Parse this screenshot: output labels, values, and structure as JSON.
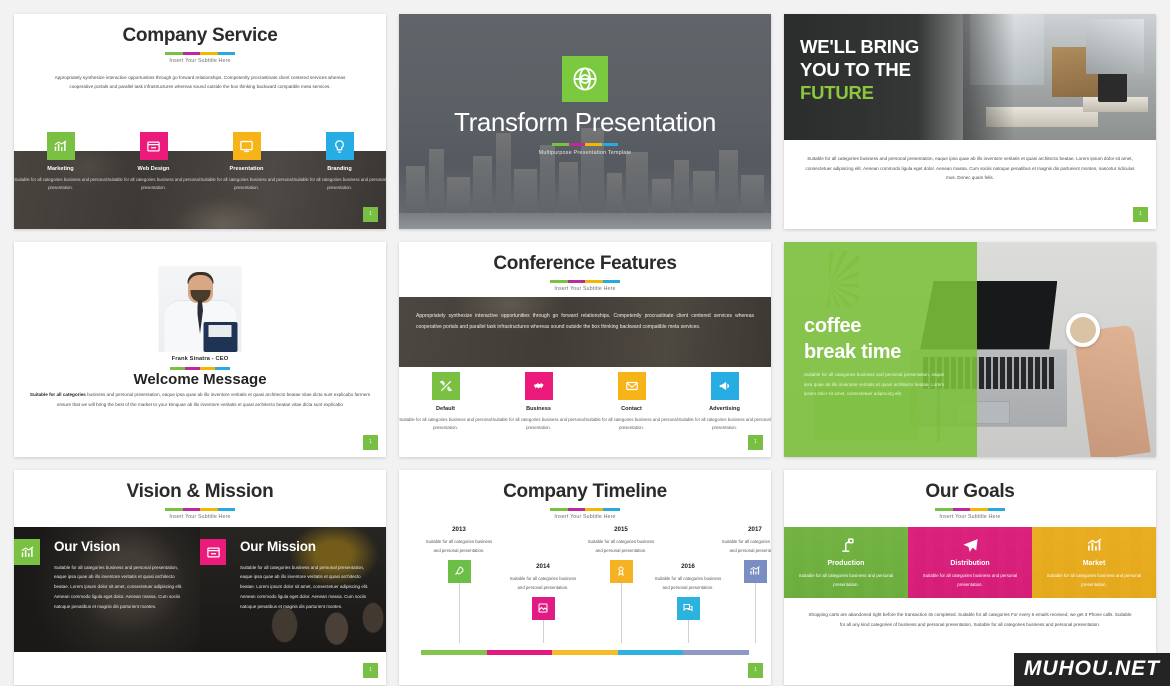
{
  "page": {
    "watermark": "MUHOU.NET",
    "page_badge": "1"
  },
  "slides": [
    {
      "id": "company-service",
      "title": "Company Service",
      "subtitle": "Insert Your Subtitle Here",
      "body": "Appropriately synthesize interactive opportunities through go forward relationships. Competently procrastinate client centered services whereas cooperative portals and parallel task infrastructures whereas sound outside the box thinking backward compatible meta services.",
      "cards": [
        {
          "icon": "bar-chart-icon",
          "color": "#7ac143",
          "title": "Marketing",
          "text": "Suitable for all categories business and personal presentation."
        },
        {
          "icon": "web-window-icon",
          "color": "#ec1a7b",
          "title": "Web Design",
          "text": "Suitable for all categories business and personal presentation."
        },
        {
          "icon": "monitor-icon",
          "color": "#f7b418",
          "title": "Presentation",
          "text": "Suitable for all categories business and personal presentation."
        },
        {
          "icon": "lightbulb-icon",
          "color": "#27ade4",
          "title": "Branding",
          "text": "Suitable for all categories business and personal presentation."
        }
      ]
    },
    {
      "id": "transform-presentation",
      "title": "Transform Presentation",
      "subtitle": "Multipurpose Presentation Template",
      "logo_icon": "globe-grid-icon",
      "logo_color": "#7ac93f"
    },
    {
      "id": "well-bring-you-to-the-future",
      "heading_line1": "WE'LL BRING",
      "heading_line2": "YOU TO THE",
      "heading_accent": "FUTURE",
      "accent_color": "#8cc63e",
      "body": "Suitable for all categories business and personal presentation, eaque ipsa quae ab illo inventore veritatis et quasi architecto beatae. Lorem ipsum dolor sit amet, consectetuer adipiscing elit. Aenean commodo ligula eget dolor. Aenean massa. Cum sociis natoque penatibus et magnis dis parturient montes, nascetur ridiculus mus. Donec quam felis."
    },
    {
      "id": "welcome-message",
      "person_name": "Frank Sinatra - CEO",
      "title": "Welcome Message",
      "body_bold": "Suitable for all categories",
      "body": " business and personal presentation, eaque ipsa quae ab illo inventore veritatis et quasi architecto beatae vitae dicta sunt explicabo farmers ensure that we will bring the best of the market to your kimquae ab illo inventore veritatis et quasi architecto beatae vitae dicta sunt explicabo"
    },
    {
      "id": "conference-features",
      "title": "Conference Features",
      "subtitle": "Insert Your Subtitle Here",
      "body": "Appropriately synthesize interactive opportunities through go forward relationships. Competently procrastinate client centered services whereas cooperative portals and parallel task infrastructures whereas sound outside the box thinking backward compatible meta services.",
      "cards": [
        {
          "icon": "tools-icon",
          "color": "#7ac143",
          "title": "Default",
          "text": "Suitable for all categories business and personal presentation."
        },
        {
          "icon": "handshake-icon",
          "color": "#ec1a7b",
          "title": "Business",
          "text": "Suitable for all categories business and personal presentation."
        },
        {
          "icon": "envelope-icon",
          "color": "#f7b418",
          "title": "Contact",
          "text": "Suitable for all categories business and personal presentation."
        },
        {
          "icon": "megaphone-icon",
          "color": "#27ade4",
          "title": "Advertising",
          "text": "Suitable for all categories business and personal presentation."
        }
      ]
    },
    {
      "id": "coffee-break-time",
      "heading_line1": "coffee",
      "heading_line2": "break time",
      "body": "Suitable for all categories business and personal presentation, eaque ipsa quae ab illo inventore veritatis et quasi architecto beatae. Lorem ipsum dolor sit amet, consectetuer adipiscing elit.",
      "overlay_color": "#7cc13b"
    },
    {
      "id": "vision-and-mission",
      "title": "Vision & Mission",
      "subtitle": "Insert Your Subtitle Here",
      "panes": [
        {
          "icon": "bar-chart-icon",
          "color": "#7ac143",
          "title": "Our Vision",
          "text": "Suitable for all categories business and personal presentation, eaque ipsa quae ab illo inventore veritatis et quasi architecto beatae. Lorem ipsum dolor sit amet, consectetuer adipiscing elit. Aenean commodo ligula eget dolor. Aenean massa. Cum sociis natoque penatibus et magnis dis parturient montes."
        },
        {
          "icon": "web-window-icon",
          "color": "#ec1a7b",
          "title": "Our Mission",
          "text": "Suitable for all categories business and personal presentation, eaque ipsa quae ab illo inventore veritatis et quasi architecto beatae. Lorem ipsum dolor sit amet, consectetuer adipiscing elit. Aenean commodo ligula eget dolor. Aenean massa. Cum sociis natoque penatibus et magnis dis parturient montes."
        }
      ]
    },
    {
      "id": "company-timeline",
      "title": "Company Timeline",
      "subtitle": "Insert Your Subtitle Here",
      "milestones": [
        {
          "year": "2013",
          "text": "Suitable for all categories business and personal presentation.",
          "icon": "rocket-icon",
          "color": "#6dbe45"
        },
        {
          "year": "2014",
          "text": "Suitable for all categories business and personal presentation.",
          "icon": "image-icon",
          "color": "#e01b84"
        },
        {
          "year": "2015",
          "text": "Suitable for all categories business and personal presentation.",
          "icon": "user-badge-icon",
          "color": "#f5b324"
        },
        {
          "year": "2016",
          "text": "Suitable for all categories business and personal presentation.",
          "icon": "chat-icon",
          "color": "#2cb3dd"
        },
        {
          "year": "2017",
          "text": "Suitable for all categories business and personal presentation.",
          "icon": "bar-chart-icon",
          "color": "#7b8ec4"
        }
      ],
      "bar_colors": [
        "#84c44c",
        "#e3197d",
        "#f5bc29",
        "#2fb2dd",
        "#8e99c6"
      ]
    },
    {
      "id": "our-goals",
      "title": "Our Goals",
      "subtitle": "Insert Your Subtitle Here",
      "panes": [
        {
          "icon": "robot-arm-icon",
          "color": "#6eba3a",
          "title": "Production",
          "text": "Suitable for all categories business and personal presentation."
        },
        {
          "icon": "paper-plane-icon",
          "color": "#e6127e",
          "title": "Distribution",
          "text": "Suitable for all categories business and personal presentation."
        },
        {
          "icon": "bar-chart-icon",
          "color": "#f5b214",
          "title": "Market",
          "text": "Suitable for all categories business and personal presentation."
        }
      ],
      "body": "Shopping carts are abandoned right before the transaction its completed. Suitable for all categories For every 6 emails received, we get 3 Phone calls. Suitable for all any kind categories of business and personal presentation, Suitable for all categories business and personal presentation."
    }
  ]
}
